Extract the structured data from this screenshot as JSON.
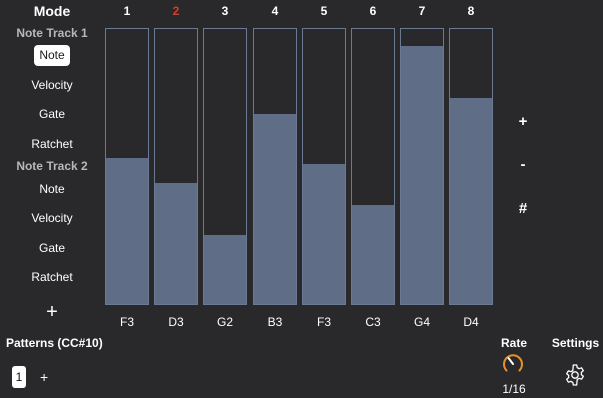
{
  "sidebar": {
    "mode_title": "Mode",
    "tracks": [
      {
        "name": "Note Track 1",
        "items": [
          "Note",
          "Velocity",
          "Gate",
          "Ratchet"
        ],
        "selected_index": 0
      },
      {
        "name": "Note Track 2",
        "items": [
          "Note",
          "Velocity",
          "Gate",
          "Ratchet"
        ],
        "selected_index": -1
      }
    ],
    "add_track_label": "+"
  },
  "sequencer": {
    "active_step": 2,
    "steps": [
      {
        "number": "1",
        "note": "F3",
        "level": 0.53
      },
      {
        "number": "2",
        "note": "D3",
        "level": 0.44
      },
      {
        "number": "3",
        "note": "G2",
        "level": 0.25
      },
      {
        "number": "4",
        "note": "B3",
        "level": 0.69
      },
      {
        "number": "5",
        "note": "F3",
        "level": 0.51
      },
      {
        "number": "6",
        "note": "C3",
        "level": 0.36
      },
      {
        "number": "7",
        "note": "G4",
        "level": 0.94
      },
      {
        "number": "8",
        "note": "D4",
        "level": 0.75
      }
    ]
  },
  "controls": {
    "plus": "+",
    "minus": "-",
    "sharp": "#"
  },
  "patterns": {
    "title": "Patterns (CC#10)",
    "current": "1",
    "add_label": "+"
  },
  "rate": {
    "label": "Rate",
    "value": "1/16",
    "knob_color": "#e8902c"
  },
  "settings": {
    "label": "Settings",
    "icon": "gear-icon"
  },
  "colors": {
    "background": "#29282a",
    "step_fill": "#5f6e86",
    "step_border": "#6a7a92",
    "active_step_number": "#d0402a"
  }
}
